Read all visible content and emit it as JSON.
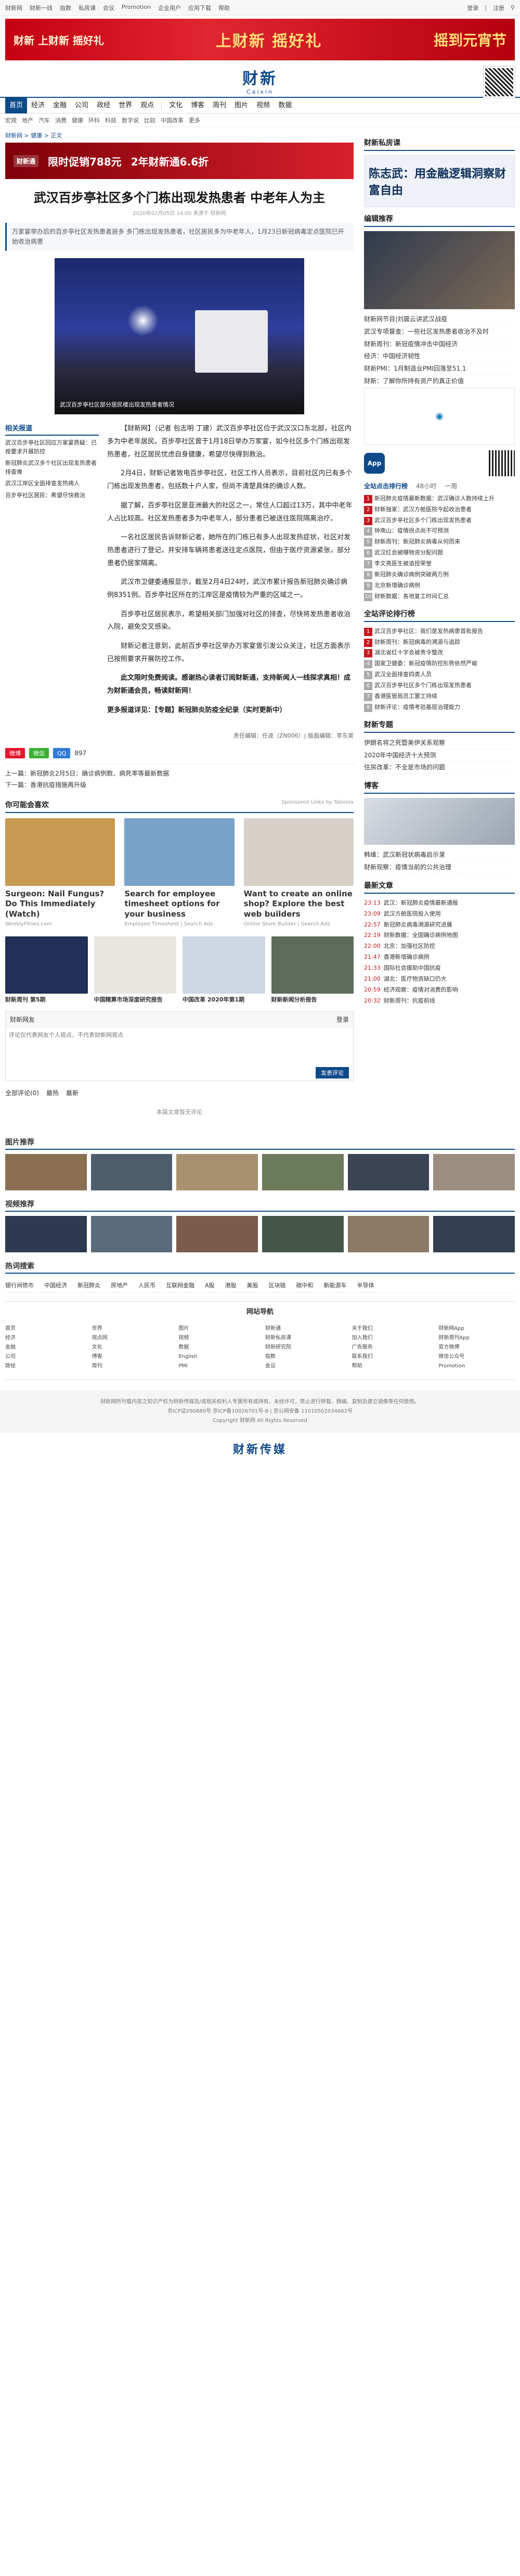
{
  "topbar": {
    "links": [
      "财新网",
      "财新一线",
      "指数",
      "私房课",
      "会议",
      "Promotion",
      "企业用户",
      "应用下载",
      "帮助"
    ],
    "login": "登录",
    "register": "注册"
  },
  "banner": {
    "left": "财新 上财新 摇好礼",
    "center": "上财新 摇好礼",
    "right": "摇到元宵节"
  },
  "logo": {
    "cn": "财新",
    "en": "Caixin"
  },
  "nav": [
    "首页",
    "经济",
    "金融",
    "公司",
    "政经",
    "世界",
    "观点",
    "文化",
    "博客",
    "周刊",
    "图片",
    "视频",
    "数据"
  ],
  "subnav": [
    "宏观",
    "地产",
    "汽车",
    "消费",
    "健康",
    "环科",
    "科技",
    "数字说",
    "比较",
    "中国改革",
    "更多"
  ],
  "crumb": "财新网 > 健康 > 正文",
  "ad1": {
    "price1": "限时促销788元",
    "price2": "2年财新通6.6折",
    "tag": "财新通"
  },
  "article": {
    "title": "武汉百步亭社区多个门栋出现发热患者 中老年人为主",
    "meta": "2020年02月05日 14:00 来源于 财新网",
    "summary": "万家宴举办后的百步亭社区发热患者居多 多门栋出现发热患者，社区居民多为中老年人，1月23日新冠病毒定点医院已开始收治病患",
    "photo_caption": "武汉百步亭社区部分居民楼出现发热患者情况",
    "p1": "【财新网】（记者 包志明 丁建）武汉百步亭社区位于武汉汉口东北部，社区内多为中老年居民。百步亭社区曾于1月18日举办万家宴，如今社区多个门栋出现发热患者，社区居民忧虑自身健康，希望尽快得到救治。",
    "p2": "2月4日，财新记者致电百步亭社区，社区工作人员表示，目前社区内已有多个门栋出现发热患者，包括数十户人家，但尚不清楚具体的确诊人数。",
    "p3": "据了解，百步亭社区是亚洲最大的社区之一，常住人口超过13万，其中中老年人占比较高。社区发热患者多为中老年人，部分患者已被送往医院隔离治疗。",
    "p4": "一名社区居民告诉财新记者，她所在的门栋已有多人出现发热症状，社区对发热患者进行了登记，并安排车辆将患者送往定点医院，但由于医疗资源紧张，部分患者仍居家隔离。",
    "p5": "武汉市卫健委通报显示，截至2月4日24时，武汉市累计报告新冠肺炎确诊病例8351例。百步亭社区所在的江岸区是疫情较为严重的区域之一。",
    "p6": "百步亭社区居民表示，希望相关部门加强对社区的排查，尽快将发热患者收治入院，避免交叉感染。",
    "p7": "财新记者注意到，此前百步亭社区举办万家宴曾引发公众关注，社区方面表示已按照要求开展防控工作。",
    "bold": "此文限时免费阅读。感谢热心读者订阅财新通，支持新闻人一线探求真相！成为财新通会员，畅读财新网！",
    "topic": "更多报道详见：【专题】新冠肺炎防疫全纪录（实时更新中）",
    "editor": "责任编辑：任波（ZN006）| 版面编辑：李东昊"
  },
  "related": {
    "title": "相关报道",
    "items": [
      "武汉百步亭社区回应万家宴质疑：已按要求开展防控",
      "新冠肺炎武汉多个社区出现发热患者排查难",
      "武汉江岸区全面排查发热病人",
      "百步亭社区居民：希望尽快救治"
    ]
  },
  "share": {
    "s1": "微博",
    "s2": "微信",
    "s3": "QQ",
    "count": "897"
  },
  "prevnext": {
    "prev": "上一篇：新冠肺炎2月5日：确诊病例数、病死率等最新数据",
    "next": "下一篇：香港抗疫措施再升级"
  },
  "recommend": {
    "title": "你可能会喜欢",
    "sponsor": "Sponsored Links by Taboola",
    "cards": [
      {
        "title": "Surgeon: Nail Fungus? Do This Immediately (Watch)",
        "source": "WeeklyFitnes.com",
        "color": "#c79a52"
      },
      {
        "title": "Search for employee timesheet options for your business",
        "source": "Employee Timesheet | Search Ads",
        "color": "#7aa3c9"
      },
      {
        "title": "Want to create an online shop? Explore the best web builders",
        "source": "Online Store Builder | Search Ads",
        "color": "#d6d0c7"
      }
    ],
    "cards2": [
      {
        "title": "财新周刊 第5期",
        "color": "#1f2f55"
      },
      {
        "title": "中国精算市场深度研究报告",
        "color": "#e9e6e0"
      },
      {
        "title": "中国改革 2020年第1期",
        "color": "#cfd7e2"
      },
      {
        "title": "财新新闻分析报告",
        "color": "#5e6a5c"
      }
    ]
  },
  "comment": {
    "title": "财新网友",
    "login": "登录",
    "placeholder": "评论仅代表网友个人观点，不代表财新网观点",
    "submit": "发表评论",
    "tab1": "全部评论(0)",
    "tab2": "最热",
    "tab3": "最新",
    "empty": "本篇文章暂无评论"
  },
  "side": {
    "class_title": "财新私房课",
    "ad_t1": "陈志武：用金融逻辑洞察财富自由",
    "editor_title": "编辑推荐",
    "editor_items": [
      "财新网节目|刘震云讲武汉战疫",
      "武汉专项督查：一些社区发热患者收治不及时",
      "财新周刊：新冠疫情冲击中国经济",
      "经济：中国经济韧性",
      "财新PMI：1月制造业PMI回落至51.1",
      "财新：了解你所持有资产的真正价值"
    ],
    "rank_tabs": [
      "全站点击排行榜",
      "48小时",
      "一周"
    ],
    "rank": [
      "新冠肺炎疫情最新数据：武汉确诊人数持续上升",
      "财新独家：武汉方舱医院今起收治患者",
      "武汉百步亭社区多个门栋出现发热患者",
      "钟南山：疫情拐点尚不可预测",
      "财新周刊：新冠肺炎病毒从何而来",
      "武汉红会被曝物资分配问题",
      "李文亮医生被追授荣誉",
      "新冠肺炎确诊病例突破两万例",
      "北京新增确诊病例",
      "财新数据：各地复工时间汇总"
    ],
    "comment_rank_title": "全站评论排行榜",
    "comment_rank": [
      "武汉百步亭社区：我们是发热病患首批报告",
      "财新周刊：新冠病毒的溯源与追踪",
      "湖北省红十字会被责令整改",
      "国家卫健委：新冠疫情防控形势依然严峻",
      "武汉全面排查四类人员",
      "武汉百步亭社区多个门栋出现发热患者",
      "香港医管局员工罢工持续",
      "财新评论：疫情考验基层治理能力"
    ],
    "special_title": "财新专题",
    "special": [
      "伊朗名将之死暨美伊关系观察",
      "2020年中国经济十大预测",
      "住房改革：不全是市场的问题"
    ],
    "blog_title": "博客",
    "blog": [
      "韩维：武汉新冠状病毒启示录",
      "财新观察：疫情当前的公共治理"
    ],
    "latest_title": "最新文章",
    "latest": [
      {
        "time": "23:13",
        "title": "武汉：新冠肺炎疫情最新通报"
      },
      {
        "time": "23:09",
        "title": "武汉方舱医院投入使用"
      },
      {
        "time": "22:57",
        "title": "新冠肺炎病毒溯源研究进展"
      },
      {
        "time": "22:19",
        "title": "财新数据：全国确诊病例地图"
      },
      {
        "time": "22:00",
        "title": "北京：加强社区防控"
      },
      {
        "time": "21:47",
        "title": "香港新增确诊病例"
      },
      {
        "time": "21:33",
        "title": "国际社会援助中国抗疫"
      },
      {
        "time": "21:00",
        "title": "湖北：医疗物资缺口仍大"
      },
      {
        "time": "20:59",
        "title": "经济观察：疫情对消费的影响"
      },
      {
        "time": "20:32",
        "title": "财新周刊：抗疫前线"
      }
    ]
  },
  "footer": {
    "photo_title": "图片推荐",
    "video_title": "视频推荐",
    "hot_title": "热词搜索",
    "hot": [
      "银行间债市",
      "中国经济",
      "新冠肺炎",
      "房地产",
      "人民币",
      "互联网金融",
      "A股",
      "港股",
      "美股",
      "区块链",
      "碳中和",
      "新能源车",
      "半导体"
    ],
    "sitemap": "网站导航",
    "map": [
      [
        "首页",
        "经济",
        "金融",
        "公司",
        "政经"
      ],
      [
        "世界",
        "观点网",
        "文化",
        "博客",
        "周刊"
      ],
      [
        "图片",
        "视频",
        "数据",
        "English",
        "PMI"
      ],
      [
        "财新通",
        "财新私房课",
        "财新研究院",
        "指数",
        "会议"
      ],
      [
        "关于我们",
        "加入我们",
        "广告服务",
        "联系我们",
        "帮助"
      ],
      [
        "财新网App",
        "财新周刊App",
        "官方微博",
        "微信公众号",
        "Promotion"
      ]
    ],
    "copyright1": "财新网所刊载内容之知识产权为财新传媒及/或相关权利人专属所有或持有。未经许可，禁止进行转载、摘编、复制及建立镜像等任何使用。",
    "copyright2": "京ICP证090880号 京ICP备10026701号-8 | 京公网安备 11010502034662号",
    "copyright3": "Copyright 财新网 All Rights Reserved",
    "bottom_logo": "财新传媒"
  }
}
